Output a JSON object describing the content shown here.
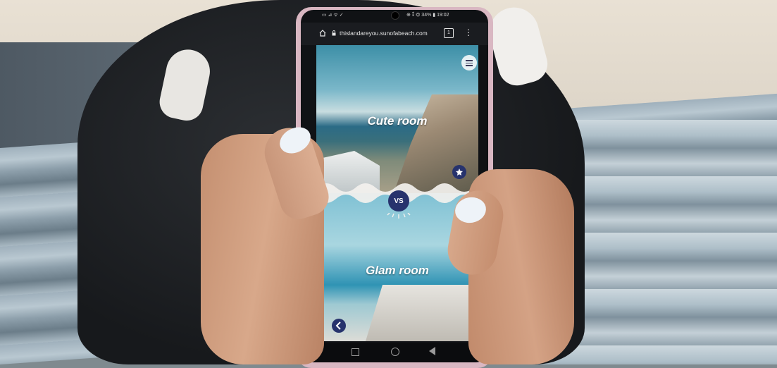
{
  "status_bar": {
    "left_text": "▭ ⊿ ᯤ ✓",
    "right_text": "⊕ ⁑ ⏣ 34% ▮ 19:02"
  },
  "browser": {
    "url": "thislandareyou.sunofabeach.com",
    "tab_count": "1",
    "icons": [
      "home-icon",
      "lock-icon",
      "tabs-icon",
      "more-menu-icon"
    ]
  },
  "page": {
    "top_label": "Cute room",
    "vs_label": "VS",
    "bottom_label": "Glam room",
    "icons": [
      "hamburger-menu-icon",
      "star-badge-icon",
      "back-chevron-icon"
    ]
  },
  "navigation_bar": {
    "icons": [
      "recents-square-icon",
      "home-circle-icon",
      "back-triangle-icon"
    ]
  },
  "colors": {
    "accent_navy": "#27336d",
    "phone_case": "#d9b7c2",
    "browser_bar": "#1a1c20"
  }
}
